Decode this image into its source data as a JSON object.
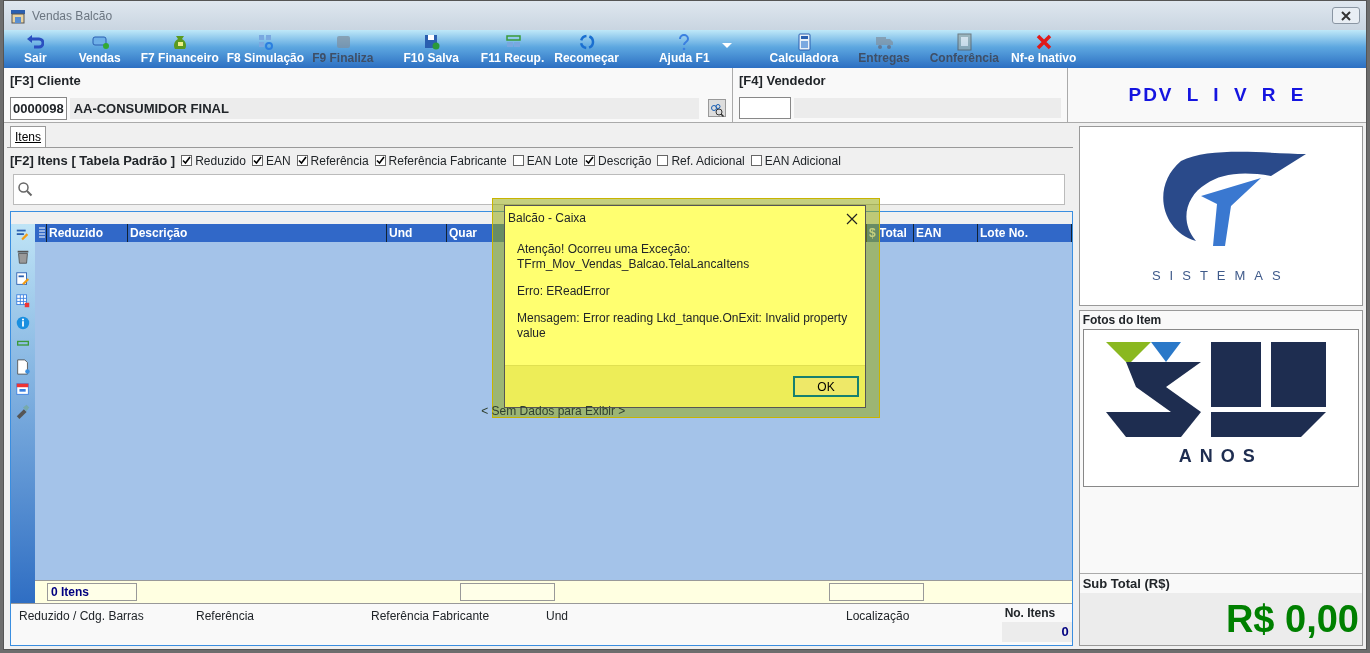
{
  "window": {
    "title": "Vendas Balcão"
  },
  "toolbar": [
    {
      "label": "Sair",
      "kind": "undo",
      "disabled": false
    },
    {
      "label": "Vendas",
      "kind": "cart",
      "disabled": false
    },
    {
      "label": "F7 Financeiro",
      "kind": "money",
      "disabled": false
    },
    {
      "label": "F8 Simulação",
      "kind": "grid",
      "disabled": false
    },
    {
      "label": "F9 Finaliza",
      "kind": "box",
      "disabled": true
    },
    {
      "label": "F10 Salva",
      "kind": "save",
      "disabled": false
    },
    {
      "label": "F11 Recup.",
      "kind": "rows",
      "disabled": false
    },
    {
      "label": "Recomeçar",
      "kind": "refresh",
      "disabled": false
    },
    {
      "label": "Ajuda F1",
      "kind": "help",
      "disabled": false
    },
    {
      "label": "Calculadora",
      "kind": "calc",
      "disabled": false
    },
    {
      "label": "Entregas",
      "kind": "truck",
      "disabled": true
    },
    {
      "label": "Conferência",
      "kind": "doc",
      "disabled": true
    },
    {
      "label": "Nf-e Inativo",
      "kind": "cross",
      "disabled": false
    }
  ],
  "cliente": {
    "label": "[F3] Cliente",
    "code": "0000098",
    "name": "AA-CONSUMIDOR FINAL"
  },
  "vendedor": {
    "label": "[F4] Vendedor"
  },
  "banner": "PDV L I V R E",
  "tabs": [
    {
      "label": "Itens",
      "selected": true
    }
  ],
  "filter": {
    "label": "[F2] Itens [ Tabela Padrão ]",
    "options": [
      {
        "label": "Reduzido",
        "checked": true
      },
      {
        "label": "EAN",
        "checked": true
      },
      {
        "label": "Referência",
        "checked": true
      },
      {
        "label": "Referência Fabricante",
        "checked": true
      },
      {
        "label": "EAN Lote",
        "checked": false
      },
      {
        "label": "Descrição",
        "checked": true
      },
      {
        "label": "Ref. Adicional",
        "checked": false
      },
      {
        "label": "EAN Adicional",
        "checked": false
      }
    ]
  },
  "grid": {
    "columns": [
      "Reduzido",
      "Descrição",
      "Und",
      "Quar",
      "$ Total",
      "EAN",
      "Lote No."
    ],
    "empty_text": "< Sem Dados para Exibir >",
    "footer_count": "0 Itens"
  },
  "item_fields": [
    "Reduzido / Cdg. Barras",
    "Referência",
    "Referência Fabricante",
    "Und",
    "Localização"
  ],
  "no_itens": {
    "label": "No. Itens",
    "value": "0"
  },
  "logo": {
    "text": "SISTEMAS"
  },
  "photos": {
    "title": "Fotos do Item",
    "caption": "ANOS"
  },
  "subtotal": {
    "label": "Sub Total (R$)",
    "value": "R$ 0,00"
  },
  "dialog": {
    "title": "Balcão - Caixa",
    "paragraphs": [
      [
        "Atenção! Ocorreu uma Exceção:",
        "TFrm_Mov_Vendas_Balcao.TelaLancaItens"
      ],
      [
        "Erro: EReadError"
      ],
      [
        "Mensagem: Error reading Lkd_tanque.OnExit: Invalid property value"
      ]
    ],
    "button": "OK"
  }
}
